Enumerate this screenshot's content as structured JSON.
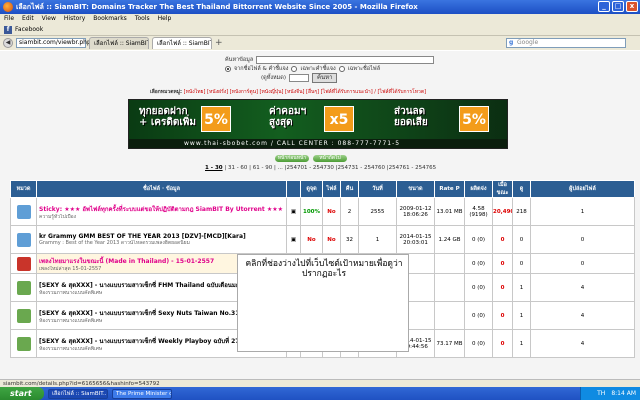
{
  "window": {
    "title": "เลือกไฟล์ :: SiamBIT: Domains Tracker The Best Thailand Bittorrent Website Since 2005 - Mozilla Firefox"
  },
  "menu": [
    "File",
    "Edit",
    "View",
    "History",
    "Bookmarks",
    "Tools",
    "Help"
  ],
  "bookmarks": [
    {
      "label": "Facebook",
      "icon": "facebook-icon"
    }
  ],
  "nav": {
    "url": "siambit.com/viewbr.php",
    "tabs": [
      {
        "label": "เลือกไฟล์ :: SiamBIT: Domains Tracker Th..."
      },
      {
        "label": "เลือกไฟล์ :: SiamBIT: Domains Tracker Th..."
      }
    ],
    "search_placeholder": "Google"
  },
  "search": {
    "label": "ค้นหาข้อมูล",
    "opt1": "จากชื่อไฟล์ & คำชี้แจง",
    "opt2": "เฉพาะคำชี้แจง",
    "opt3": "เฉพาะชื่อไฟล์",
    "page_label": "(ดูทั้งหมด)",
    "button": "ค้นหา"
  },
  "categories": {
    "label": "เลือกหมวดหมู่:",
    "list": "[หนังไทย] [หนังฝรั่ง] [หนังการ์ตูน] [หนังญี่ปุ่น] [หนังจีน] [อื่นๆ] [ไฟล์ที่ได้รับการแนะนำ] / [ไฟล์ที่ได้รับการโหวต]"
  },
  "banner": {
    "t1": "ทุกยอดฝาก",
    "t1b": "+ เครดิตเพิ่ม",
    "p1": "5%",
    "t2": "ค่าคอมฯ",
    "t2b": "สูงสุด",
    "p2": "x5",
    "t3": "ส่วนลด",
    "t3b": "ยอดเสีย",
    "p3": "5%",
    "strip": "www.thai-sbobet.com  /  CALL CENTER : 088-777-7771-5"
  },
  "pager": {
    "buttons": [
      "หน้าก่อนหน้า",
      "หน้าถัดไป"
    ],
    "current": "1 - 30",
    "rest": "| 31 - 60 | 61 - 90 | ... |254701 - 254730 |254731 - 254760 |254761 - 254765"
  },
  "table": {
    "headers": [
      "หมวด",
      "ชื่อไฟล์ · ข้อมูล",
      "",
      "ดูจุด",
      "ไฟล์",
      "คืน",
      "วันที่",
      "ขนาด",
      "Rate P",
      "ผลิตจ่ง",
      "เมื่อขณะ",
      "ดู",
      "ผู้ปล่อยไฟล์"
    ],
    "rows": [
      {
        "cat_color": "#5f9ed6",
        "name": "Sticky: ★★★ อัพไฟล์ทุกครั้งที่ระบบแต่ขอให้ปฏิบัติตามกฎ SiamBIT By Utorrent ★★★",
        "sub": "ความรู้ทั่วไปเบื้อง",
        "pink": true,
        "pct": "100%",
        "a": "No",
        "b": "2",
        "c": "2555",
        "date": "2009-01-12 18:06:26",
        "size": "13.01 MB",
        "rate": "4.58 (9198)",
        "seed": "20,490",
        "leech": "218",
        "views": "1",
        "uploader": "ACTIeTe",
        "up_pink": true
      },
      {
        "cat_color": "#5f9ed6",
        "name": "kr Grammy GMM BEST OF THE YEAR 2013 [DZV]-[MCD][Kara]",
        "sub": "Grammy : Best of the Year 2013 ดาวน์โหลดรวมเพลงฮิตยอดนิยม",
        "pink": false,
        "pct": "No",
        "a": "No",
        "b": "32",
        "c": "1",
        "date": "2014-01-15 20:03:01",
        "size": "1.24 GB",
        "rate": "0 (0)",
        "seed": "0",
        "leech": "0",
        "views": "0",
        "uploader": "ฮ่w2",
        "up_pink": false
      },
      {
        "cat_color": "#c9342a",
        "name": "เพลงไทยมาแรงในขณะนี้ (Made in Thailand) - 15-01-2557",
        "sub": "เพลงใหม่ล่าสุด 15-01-2557",
        "pink": true,
        "pct": "No",
        "a": "",
        "b": "",
        "c": "",
        "date": "",
        "size": "",
        "rate": "0 (0)",
        "seed": "0",
        "leech": "0",
        "views": "0",
        "uploader": "Thaiman",
        "up_pink": false
      },
      {
        "cat_color": "#6aa84f",
        "name": "[SEXY & สุดXXX] - นางแบบรวมสาวเซ็กซี่ FHM Thailand ฉบับเดือนมกราคม 2014",
        "sub": "ห้องรวมภาพนางแบบคัดพิเศษ",
        "pink": false,
        "pct": "No",
        "a": "",
        "b": "",
        "c": "",
        "date": "",
        "size": "",
        "rate": "0 (0)",
        "seed": "0",
        "leech": "1",
        "views": "4",
        "uploader": "BJcool",
        "up_pink": false
      },
      {
        "cat_color": "#6aa84f",
        "name": "[SEXY & สุดXXX] - นางแบบรวมสาวเซ็กซี่ Sexy Nuts Taiwan No.31 2014",
        "sub": "ห้องรวมภาพนางแบบคัดพิเศษ",
        "pink": false,
        "pct": "No",
        "a": "",
        "b": "",
        "c": "",
        "date": "",
        "size": "",
        "rate": "0 (0)",
        "seed": "0",
        "leech": "1",
        "views": "4",
        "uploader": "BJcool",
        "up_pink": false
      },
      {
        "cat_color": "#6aa84f",
        "name": "[SEXY & สุดXXX] - นางแบบรวมสาวเซ็กซี่ Weekly Playboy ฉบับที่ 27",
        "sub": "ห้องรวมภาพนางแบบคัดพิเศษ",
        "pink": false,
        "pct": "No",
        "a": "No",
        "b": "",
        "c": "",
        "date": "2014-01-15 19:44:56",
        "size": "73.17 MB",
        "rate": "0 (0)",
        "seed": "0",
        "leech": "1",
        "views": "4",
        "uploader": "BJcool",
        "up_pink": false
      }
    ]
  },
  "popup": {
    "text": "คลิกที่ช่องว่างไปที่เว็บไซต์เป้าหมายเพื่อดูว่าปรากฏอะไร"
  },
  "status": {
    "text": "siambit.com/details.php?id=6165656&hashinfo=543792"
  },
  "taskbar": {
    "start": "start",
    "tasks": [
      "เลือกไฟล์ :: SiamBIT...",
      "The Prime Minister on..."
    ],
    "lang": "TH",
    "time": "8:14 AM"
  },
  "colors": {
    "header_bg": "#2c5e93",
    "titlebar": "#1c4fc4"
  }
}
